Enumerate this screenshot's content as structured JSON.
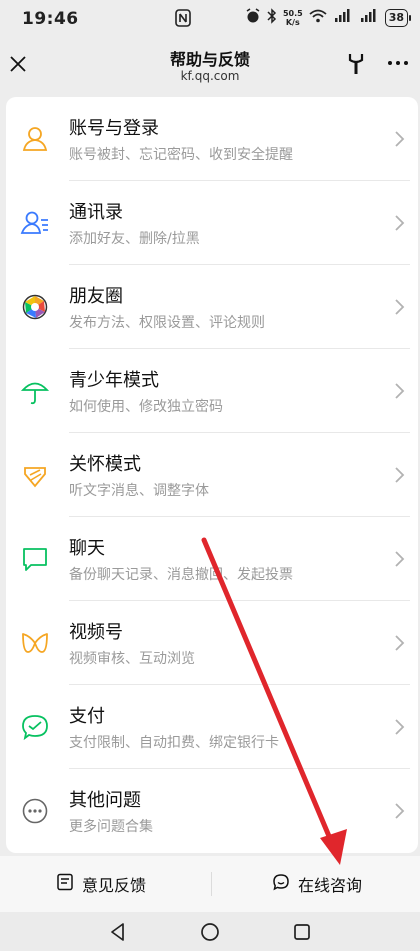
{
  "status_bar": {
    "time": "19:46",
    "net_speed_value": "50.5",
    "net_speed_unit": "K/s",
    "battery": "38"
  },
  "nav": {
    "title": "帮助与反馈",
    "subtitle": "kf.qq.com"
  },
  "menu": {
    "items": [
      {
        "title": "账号与登录",
        "desc": "账号被封、忘记密码、收到安全提醒",
        "icon": "account-icon"
      },
      {
        "title": "通讯录",
        "desc": "添加好友、删除/拉黑",
        "icon": "contacts-icon"
      },
      {
        "title": "朋友圈",
        "desc": "发布方法、权限设置、评论规则",
        "icon": "moments-icon"
      },
      {
        "title": "青少年模式",
        "desc": "如何使用、修改独立密码",
        "icon": "umbrella-icon"
      },
      {
        "title": "关怀模式",
        "desc": "听文字消息、调整字体",
        "icon": "care-icon"
      },
      {
        "title": "聊天",
        "desc": "备份聊天记录、消息撤回、发起投票",
        "icon": "chat-icon"
      },
      {
        "title": "视频号",
        "desc": "视频审核、互动浏览",
        "icon": "channels-icon"
      },
      {
        "title": "支付",
        "desc": "支付限制、自动扣费、绑定银行卡",
        "icon": "pay-icon"
      },
      {
        "title": "其他问题",
        "desc": "更多问题合集",
        "icon": "more-dots-icon"
      }
    ]
  },
  "bottom_bar": {
    "feedback_label": "意见反馈",
    "consult_label": "在线咨询"
  },
  "colors": {
    "orange": "#f5a623",
    "blue": "#3a7afe",
    "green": "#07c160",
    "annotation_red": "#e0262c"
  }
}
